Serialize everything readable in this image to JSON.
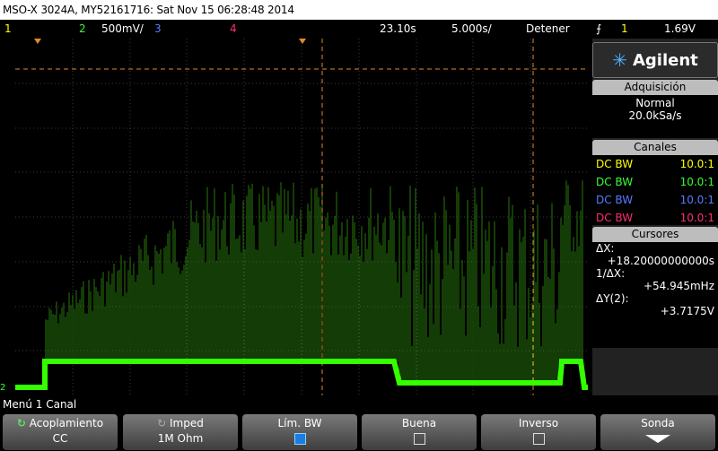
{
  "titlebar": {
    "text": "MSO-X 3024A, MY52161716: Sat Nov 15 06:28:48 2014"
  },
  "status": {
    "ch1": "1",
    "ch2": "2",
    "ch2_scale": "500mV/",
    "ch3": "3",
    "ch4": "4",
    "time_offset": "23.10s",
    "time_scale": "5.000s/",
    "run_state": "Detener",
    "trigger_symbol": "⨍",
    "trigger_ch": "1",
    "trigger_level": "1.69V"
  },
  "brand": {
    "name": "Agilent"
  },
  "acquisition": {
    "title": "Adquisición",
    "mode": "Normal",
    "rate": "20.0kSa/s"
  },
  "channels": {
    "title": "Canales",
    "rows": [
      {
        "coupling": "DC BW",
        "probe": "10.0:1",
        "color": "#ffff00"
      },
      {
        "coupling": "DC BW",
        "probe": "10.0:1",
        "color": "#33ff33"
      },
      {
        "coupling": "DC BW",
        "probe": "10.0:1",
        "color": "#5a7aff"
      },
      {
        "coupling": "DC BW",
        "probe": "10.0:1",
        "color": "#ff2d6e"
      }
    ]
  },
  "cursors": {
    "title": "Cursores",
    "dx_label": "ΔX:",
    "dx_value": "+18.20000000000s",
    "inv_label": "1/ΔX:",
    "inv_value": "+54.945mHz",
    "dy_label": "ΔY(2):",
    "dy_value": "+3.7175V"
  },
  "menu": {
    "title": "Menú 1 Canal"
  },
  "softkeys": [
    {
      "label": "Acoplamiento",
      "value": "CC"
    },
    {
      "label": "Imped",
      "value": "1M Ohm"
    },
    {
      "label": "Lím. BW",
      "value": ""
    },
    {
      "label": "Buena",
      "value": ""
    },
    {
      "label": "Inverso",
      "value": ""
    },
    {
      "label": "Sonda",
      "value": ""
    }
  ],
  "screen": {
    "ch2_marker": "2",
    "trace_color": "#33ff00"
  }
}
